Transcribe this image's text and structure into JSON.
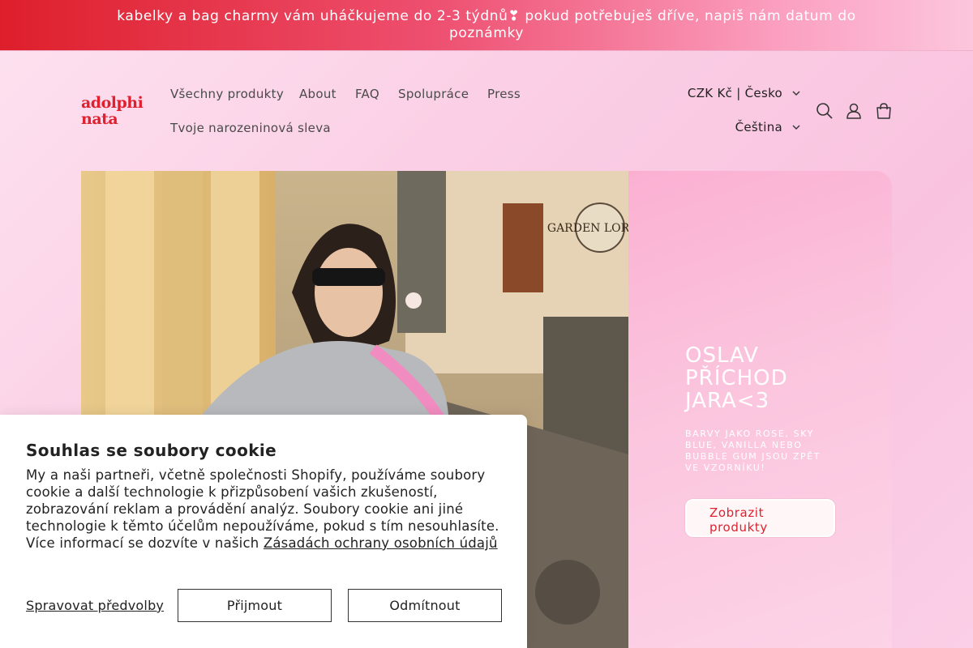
{
  "announcement": {
    "text": "kabelky a bag charmy vám uháčkujeme do 2-3 týdnů❣ pokud potřebuješ dříve, napiš nám datum do poznámky"
  },
  "header": {
    "logo_line1": "adolphi",
    "logo_line2": "nata",
    "nav": {
      "all_products": "Všechny produkty",
      "about": "About",
      "faq": "FAQ",
      "cooperation": "Spolupráce",
      "press": "Press",
      "birthday": "Tvoje narozeninová sleva"
    },
    "currency": "CZK Kč | Česko",
    "language": "Čeština",
    "icons": [
      "search-icon",
      "account-icon",
      "cart-icon"
    ]
  },
  "hero": {
    "title": "OSLAV PŘÍCHOD JARA<3",
    "subtitle": "BARVY JAKO ROSE, SKY BLUE, VANILLA NEBO BUBBLE GUM JSOU ZPĚT VE VZORNÍKU!",
    "button": "Zobrazit produkty",
    "image_sign_text": "GARDEN LORETA"
  },
  "cookie": {
    "title": "Souhlas se soubory cookie",
    "body": "My a naši partneři, včetně společnosti Shopify, používáme soubory cookie a další technologie k přizpůsobení vašich zkušeností, zobrazování reklam a provádění analýz. Soubory cookie ani jiné technologie k těmto účelům nepoužíváme, pokud s tím nesouhlasíte. Více informací se dozvíte v našich ",
    "link": "Zásadách ochrany osobních údajů",
    "manage": "Spravovat předvolby",
    "accept": "Přijmout",
    "decline": "Odmítnout"
  },
  "colors": {
    "brand_red": "#e0202e",
    "pink_bg": "#fbd0e6",
    "hero_panel": "#fbc5de"
  }
}
